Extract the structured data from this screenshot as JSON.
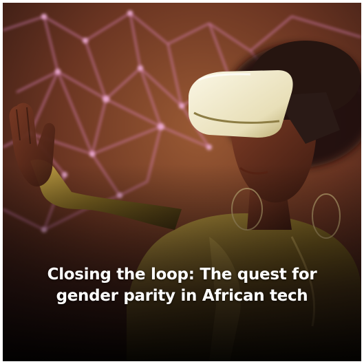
{
  "article": {
    "headline_line1": "Closing the loop: The quest for",
    "headline_line2": "gender parity in African tech"
  },
  "image": {
    "subject": "Person wearing a white VR headset reaching out toward a glowing network of lines",
    "palette": {
      "background_warm": "#8a4a2c",
      "background_dark": "#1a0e0b",
      "network_glow": "#e07bc0",
      "headset": "#f1ecd9",
      "jacket_gold": "#b08a32"
    }
  }
}
